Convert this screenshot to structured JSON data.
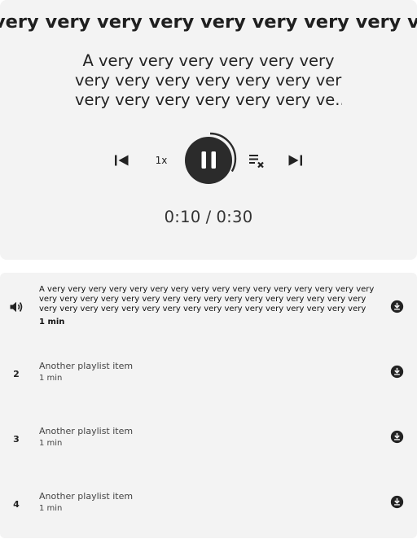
{
  "player": {
    "marquee_title": "very very very very very very very very very very very very",
    "subtitle_lines": [
      "A very very very very very very",
      "very very very very very very very",
      "very very very very very very ve..."
    ],
    "speed": "1x",
    "progress_fraction": 0.333,
    "time_current": "0:10",
    "time_separator": "/",
    "time_total": "0:30"
  },
  "playlist": {
    "items": [
      {
        "marker": "speaker-icon",
        "title": "A very very very very very very very very very very very very very very very very very very very very very very very very very very very very very very very very very very very very very very very very very very very very very very very very very very long...",
        "duration": "1 min",
        "active": true
      },
      {
        "marker": "2",
        "title": "Another playlist item",
        "duration": "1 min"
      },
      {
        "marker": "3",
        "title": "Another playlist item",
        "duration": "1 min"
      },
      {
        "marker": "4",
        "title": "Another playlist item",
        "duration": "1 min"
      }
    ]
  },
  "colors": {
    "panel_bg": "#f3f3f3",
    "play_button": "#2b2b2b",
    "icon": "#222222"
  }
}
